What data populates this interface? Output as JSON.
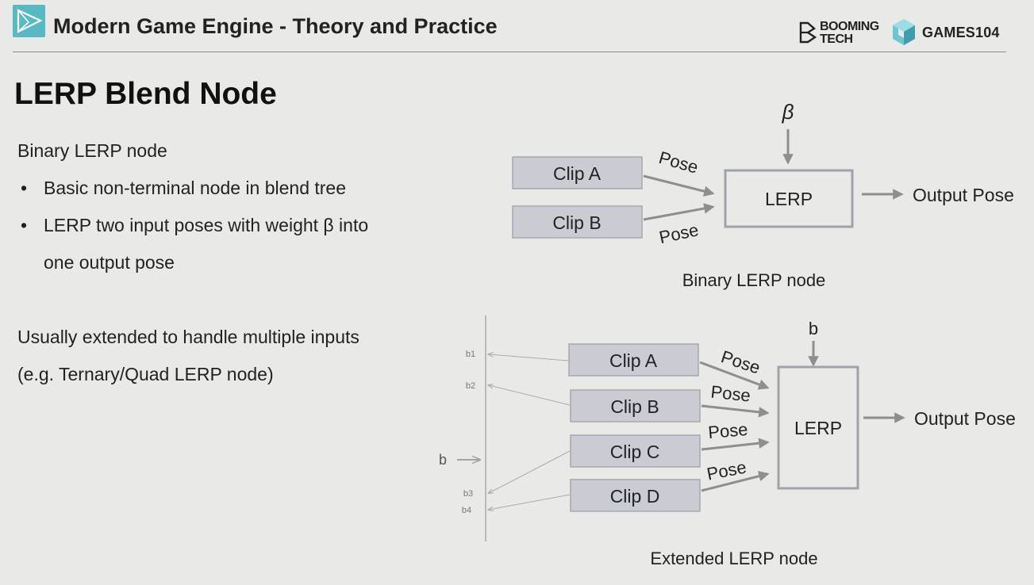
{
  "header": {
    "course_title": "Modern Game Engine - Theory and Practice",
    "brand_booming_line1": "BOOMING",
    "brand_booming_line2": "TECH",
    "brand_games": "GAMES104"
  },
  "slide": {
    "title": "LERP Blend Node",
    "section1_heading": "Binary LERP node",
    "bullets": [
      {
        "dot": "•",
        "line1": "Basic non-terminal node in blend tree",
        "line2": ""
      },
      {
        "dot": "•",
        "line1": "LERP two input poses with weight β into",
        "line2": "one output pose"
      }
    ],
    "section2_line1": "Usually extended to handle multiple inputs",
    "section2_line2": "(e.g. Ternary/Quad LERP node)"
  },
  "binary_diagram": {
    "weight": "β",
    "clips": [
      "Clip A",
      "Clip B"
    ],
    "edge_labels": [
      "Pose",
      "Pose"
    ],
    "node": "LERP",
    "output": "Output Pose",
    "caption": "Binary LERP node"
  },
  "extended_diagram": {
    "weight": "b",
    "clips": [
      "Clip A",
      "Clip B",
      "Clip C",
      "Clip D"
    ],
    "edge_labels": [
      "Pose",
      "Pose",
      "Pose",
      "Pose"
    ],
    "node": "LERP",
    "output": "Output Pose",
    "caption": "Extended LERP node",
    "axis_input": "b",
    "axis_ticks": [
      "b1",
      "b2",
      "b3",
      "b4"
    ]
  },
  "colors": {
    "background": "#e9e9e7",
    "clip_fill": "#c9cdd3",
    "clip_border": "#a4a8ad",
    "node_border": "#9ea3aa",
    "arrow": "#8e8e8e",
    "brand_accent": "#56b9c3"
  }
}
